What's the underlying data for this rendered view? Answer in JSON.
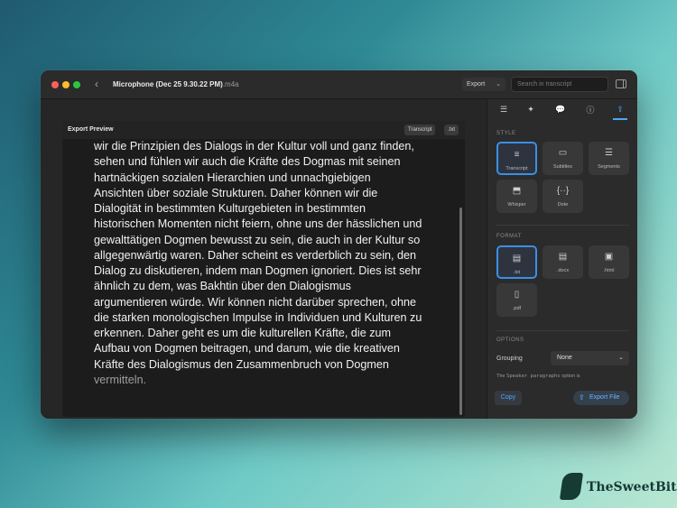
{
  "window": {
    "title": "Microphone (Dec 25 9.30.22 PM)",
    "title_ext": ".m4a",
    "export_dropdown": "Export",
    "search_placeholder": "Search in transcript"
  },
  "preview": {
    "title": "Export Preview",
    "chip_format": "Transcript",
    "chip_ext": ".txt",
    "lines": [
      "wir die Prinzipien des Dialogs in der Kultur voll und ganz finden,",
      "sehen und fühlen wir auch die Kräfte des Dogmas mit seinen",
      "hartnäckigen sozialen Hierarchien und unnachgiebigen",
      "Ansichten über soziale Strukturen. Daher können wir die",
      "Dialogität in bestimmten Kulturgebieten in bestimmten",
      "historischen Momenten nicht feiern, ohne uns der hässlichen und",
      "gewalttätigen Dogmen bewusst zu sein, die auch in der Kultur so",
      "allgegenwärtig waren. Daher scheint es verderblich zu sein, den",
      "Dialog zu diskutieren, indem man Dogmen ignoriert. Dies ist sehr",
      "ähnlich zu dem, was Bakhtin über den Dialogismus",
      "argumentieren würde. Wir können nicht darüber sprechen, ohne",
      "die starken monologischen Impulse in Individuen und Kulturen zu",
      "erkennen. Daher geht es um die kulturellen Kräfte, die zum",
      "Aufbau von Dogmen beitragen, und darum, wie die kreativen",
      "Kräfte des Dialogismus den Zusammenbruch von Dogmen",
      "vermitteln."
    ]
  },
  "panel": {
    "tabs": [
      {
        "name": "tab-transcript-settings",
        "icon": "list-icon",
        "glyph": "☰"
      },
      {
        "name": "tab-ai",
        "icon": "sparkles-icon",
        "glyph": "✦"
      },
      {
        "name": "tab-translate",
        "icon": "speech-bubbles-icon",
        "glyph": "💬"
      },
      {
        "name": "tab-info",
        "icon": "info-icon",
        "glyph": "ⓘ"
      },
      {
        "name": "tab-export",
        "icon": "share-icon",
        "glyph": "⇪"
      }
    ],
    "style_label": "STYLE",
    "style_tiles": [
      {
        "label": "Transcript",
        "icon": "transcript-icon",
        "glyph": "≡",
        "selected": true
      },
      {
        "label": "Subtitles",
        "icon": "subtitles-icon",
        "glyph": "▭",
        "selected": false
      },
      {
        "label": "Segments",
        "icon": "segments-icon",
        "glyph": "☰",
        "selected": false
      },
      {
        "label": "Whisper",
        "icon": "whisper-icon",
        "glyph": "⬒",
        "selected": false
      },
      {
        "label": "Dote",
        "icon": "dote-icon",
        "glyph": "{··}",
        "selected": false
      }
    ],
    "format_label": "FORMAT",
    "format_tiles": [
      {
        "label": ".txt",
        "icon": "txt-file-icon",
        "glyph": "▤",
        "selected": true
      },
      {
        "label": ".docx",
        "icon": "docx-file-icon",
        "glyph": "▤",
        "selected": false
      },
      {
        "label": ".html",
        "icon": "html-file-icon",
        "glyph": "▣",
        "selected": false
      },
      {
        "label": ".pdf",
        "icon": "pdf-file-icon",
        "glyph": "▯",
        "selected": false
      }
    ],
    "options_label": "OPTIONS",
    "grouping_label": "Grouping",
    "grouping_value": "None",
    "note_prefix": "The ",
    "note_mono": "Speaker paragraphs",
    "note_suffix": " option is",
    "copy_label": "Copy",
    "export_file_label": "Export File",
    "accent": "#4aa7ff"
  },
  "brand": {
    "name": "TheSweetBits"
  }
}
